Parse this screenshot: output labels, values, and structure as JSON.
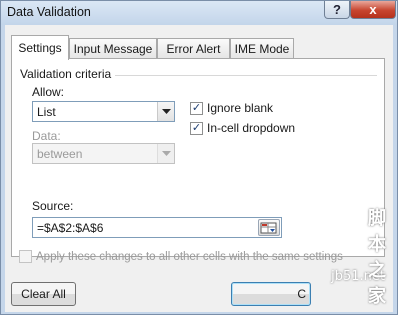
{
  "window": {
    "title": "Data Validation",
    "help_icon": "?",
    "close_icon": "x"
  },
  "tabs": [
    {
      "label": "Settings",
      "active": true
    },
    {
      "label": "Input Message",
      "active": false
    },
    {
      "label": "Error Alert",
      "active": false
    },
    {
      "label": "IME Mode",
      "active": false
    }
  ],
  "settings": {
    "group_label": "Validation criteria",
    "allow_label": "Allow:",
    "allow_value": "List",
    "data_label": "Data:",
    "data_value": "between",
    "ignore_blank_label": "Ignore blank",
    "ignore_blank_checked": true,
    "in_cell_dropdown_label": "In-cell dropdown",
    "in_cell_dropdown_checked": true,
    "source_label": "Source:",
    "source_value": "=$A$2:$A$6",
    "apply_label": "Apply these changes to all other cells with the same settings",
    "apply_checked": false
  },
  "buttons": {
    "clear_all": "Clear All",
    "ok": "C"
  },
  "watermark": {
    "line1": "jb51.net",
    "line2": "脚本之家"
  },
  "icons": {
    "dropdown_arrow": "chevron-down-icon",
    "check": "checkmark-icon",
    "range_select": "range-select-icon"
  }
}
